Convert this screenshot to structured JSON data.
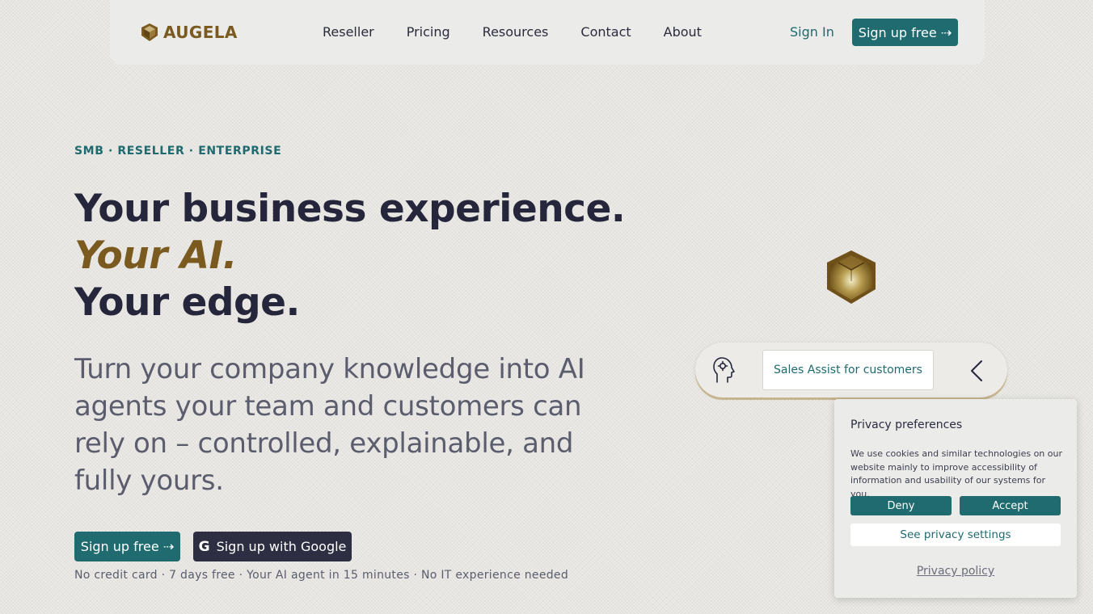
{
  "brand": {
    "name": "AUGELA"
  },
  "nav": {
    "links": [
      "Reseller",
      "Pricing",
      "Resources",
      "Contact",
      "About"
    ],
    "signin": "Sign In",
    "signup": "Sign up free ⇢"
  },
  "hero": {
    "eyebrow": "SMB · RESELLER · ENTERPRISE",
    "headline_line1": "Your business experience.",
    "headline_line2": "Your AI.",
    "headline_line3": "Your edge.",
    "subtext": "Turn your company knowledge into AI agents your team and customers can rely on – controlled, explainable, and fully yours.",
    "cta_primary": "Sign up free ⇢",
    "cta_google": "Sign up with Google",
    "fine_print": "No credit card · 7 days free · Your AI agent in 15 minutes · No IT experience needed"
  },
  "agent": {
    "label": "Sales Assist for customers",
    "icons": {
      "head": "head-gear-icon",
      "prev": "chevron-left-icon"
    }
  },
  "privacy": {
    "title": "Privacy preferences",
    "text": "We use cookies and similar technologies on our website mainly to improve accessibility of information and usability of our systems for you.",
    "deny": "Deny",
    "accept": "Accept",
    "settings": "See privacy settings",
    "policy": "Privacy policy"
  },
  "colors": {
    "teal": "#1f6b6f",
    "gold": "#7a5a1e",
    "navy": "#25263b"
  }
}
